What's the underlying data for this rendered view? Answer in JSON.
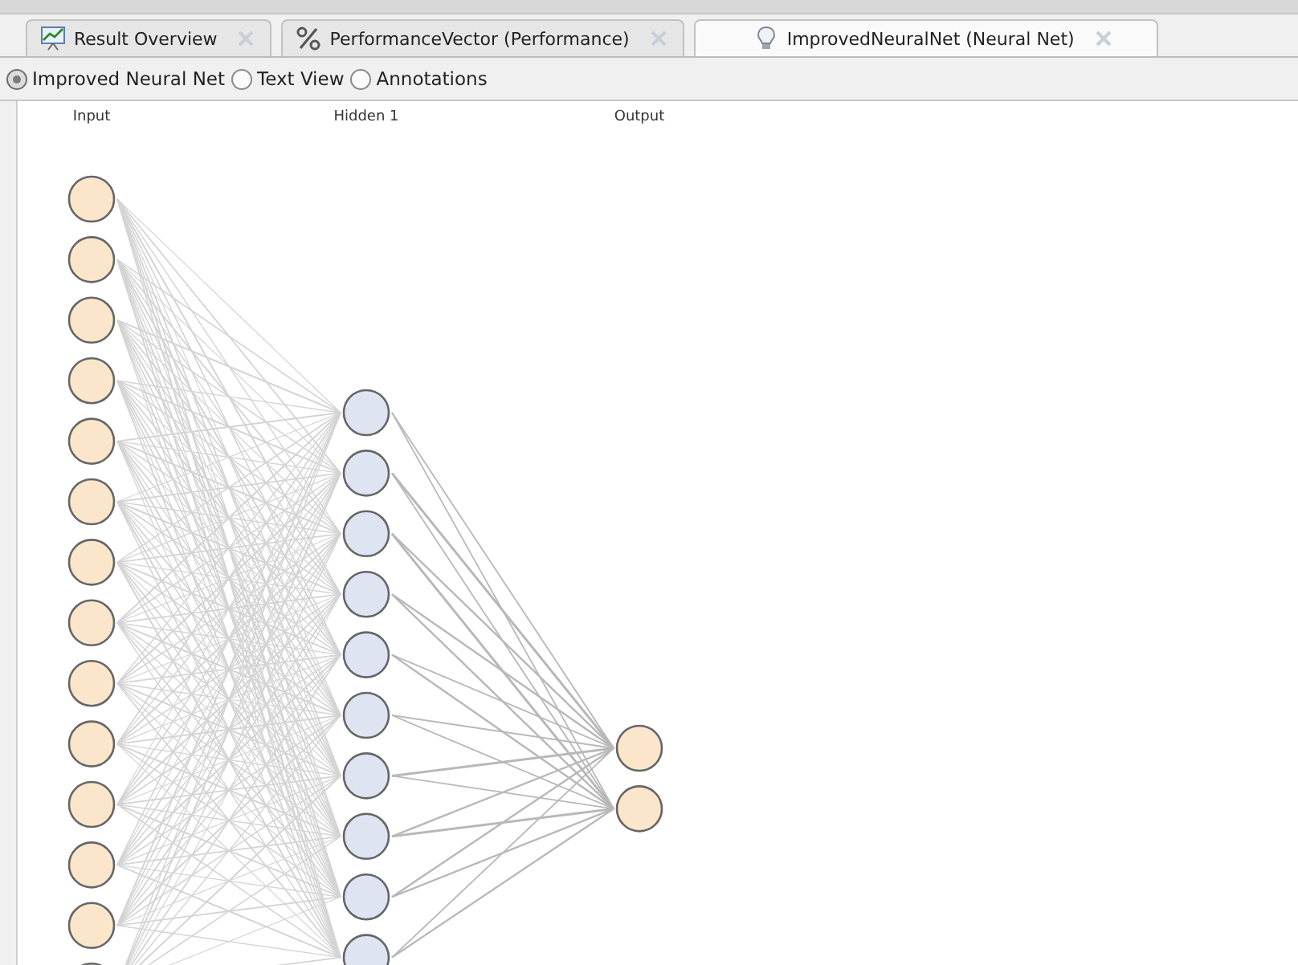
{
  "tabs": [
    {
      "label": "Result Overview",
      "kind": "chart",
      "selected": false
    },
    {
      "label": "PerformanceVector (Performance)",
      "kind": "percent",
      "selected": false
    },
    {
      "label": "ImprovedNeuralNet (Neural Net)",
      "kind": "bulb",
      "selected": true
    }
  ],
  "view_options": [
    {
      "label": "Improved Neural Net",
      "selected": true
    },
    {
      "label": "Text View",
      "selected": false
    },
    {
      "label": "Annotations",
      "selected": false
    }
  ],
  "network": {
    "layers": [
      {
        "label": "Input",
        "color": "#fbe6cc"
      },
      {
        "label": "Hidden 1",
        "color": "#dfe4f3"
      },
      {
        "label": "Output",
        "color": "#fbe6cc"
      }
    ]
  }
}
